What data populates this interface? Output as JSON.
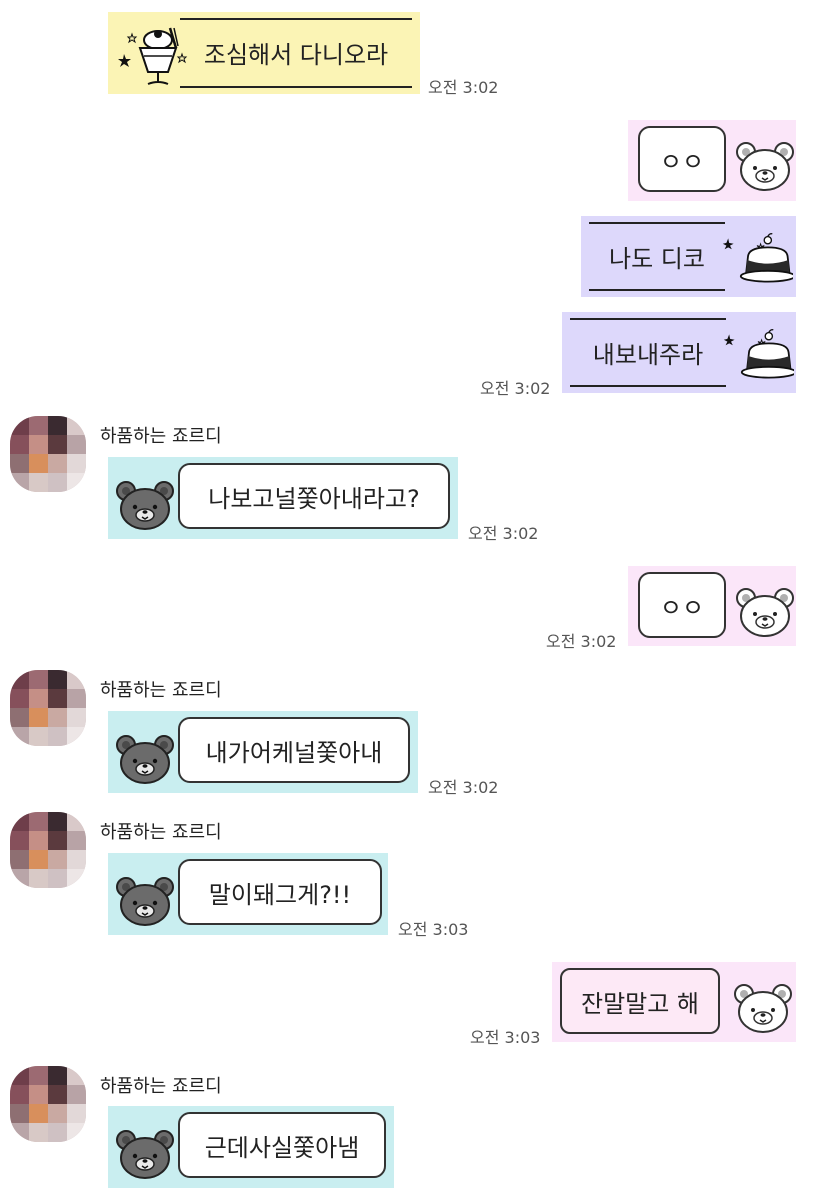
{
  "chat": {
    "partner_name": "하품하는 죠르디",
    "messages": [
      {
        "id": "m1",
        "sender": "me",
        "text": "조심해서 다니오라",
        "time": "오전 3:02"
      },
      {
        "id": "m2",
        "sender": "other",
        "text": "ㅇㅇ"
      },
      {
        "id": "m3",
        "sender": "other",
        "text": "나도 디코"
      },
      {
        "id": "m4",
        "sender": "other",
        "text": "내보내주라",
        "time": "오전 3:02"
      },
      {
        "id": "m5",
        "sender": "partner",
        "name": "하품하는 죠르디",
        "text": "나보고널쫓아내라고?",
        "time": "오전 3:02"
      },
      {
        "id": "m6",
        "sender": "other",
        "text": "ㅇㅇ",
        "time": "오전 3:02"
      },
      {
        "id": "m7",
        "sender": "partner",
        "name": "하품하는 죠르디",
        "text": "내가어케널쫓아내",
        "time": "오전 3:02"
      },
      {
        "id": "m8",
        "sender": "partner",
        "name": "하품하는 죠르디",
        "text": "말이돼그게?!!",
        "time": "오전 3:03"
      },
      {
        "id": "m9",
        "sender": "other",
        "text": "잔말말고 해",
        "time": "오전 3:03"
      },
      {
        "id": "m10",
        "sender": "partner",
        "name": "하품하는 죠르디",
        "text": "근데사실쫓아냄"
      }
    ]
  },
  "colors": {
    "parfait_bg": "#fbf4b5",
    "pudding_bg": "#ddd8fb",
    "bear_pink_bg": "#fbe6f9",
    "bear_gray_bg": "#c9eef0"
  },
  "icons": {
    "parfait": "parfait-sticker-icon",
    "pudding": "pudding-sticker-icon",
    "white_bear": "white-bear-icon",
    "gray_bear": "gray-bear-icon"
  }
}
